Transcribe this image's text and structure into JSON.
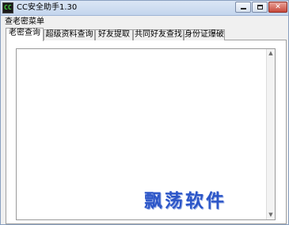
{
  "window": {
    "title": "CC安全助手1.30",
    "icon_text": "CC",
    "minimize_glyph": "",
    "maximize_glyph": "",
    "close_glyph": "✕"
  },
  "menu": {
    "items": [
      {
        "label": "查老密菜单"
      }
    ]
  },
  "tabs": [
    {
      "label": "老密查询",
      "active": true
    },
    {
      "label": "超级资料查询",
      "active": false
    },
    {
      "label": "好友提取",
      "active": false
    },
    {
      "label": "共同好友查找",
      "active": false
    },
    {
      "label": "身份证爆破",
      "active": false
    }
  ],
  "output": {
    "value": ""
  },
  "scrollbar": {
    "up": "▲",
    "down": "▼"
  },
  "watermark": {
    "text": "飘荡软件",
    "color": "#2c56c8"
  }
}
